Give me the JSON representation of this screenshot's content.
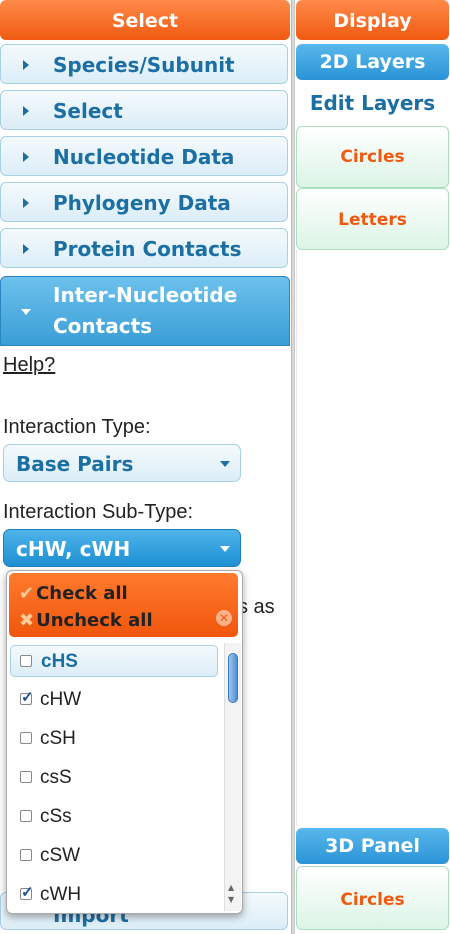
{
  "left_panel": {
    "header": "Select",
    "accordion": [
      {
        "label": "Species/Subunit"
      },
      {
        "label": "Select"
      },
      {
        "label": "Nucleotide Data"
      },
      {
        "label": "Phylogeny Data"
      },
      {
        "label": "Protein Contacts"
      }
    ],
    "open_section": {
      "line1": "Inter-Nucleotide",
      "line2": "Contacts"
    },
    "help_link": "Help?",
    "interaction_type": {
      "label": "Interaction Type:",
      "value": "Base Pairs"
    },
    "interaction_subtype": {
      "label": "Interaction Sub-Type:",
      "value": "cHW, cWH"
    },
    "partial_text": "s as",
    "dropdown": {
      "check_all": "Check all",
      "uncheck_all": "Uncheck all",
      "options": [
        {
          "label": "cHS",
          "checked": false,
          "hover": true
        },
        {
          "label": "cHW",
          "checked": true,
          "hover": false
        },
        {
          "label": "cSH",
          "checked": false,
          "hover": false
        },
        {
          "label": "csS",
          "checked": false,
          "hover": false
        },
        {
          "label": "cSs",
          "checked": false,
          "hover": false
        },
        {
          "label": "cSW",
          "checked": false,
          "hover": false
        },
        {
          "label": "cWH",
          "checked": true,
          "hover": false
        }
      ]
    },
    "bottom_section": "Import"
  },
  "right_panel": {
    "header": "Display",
    "tab_2d": "2D Layers",
    "edit_layers": "Edit Layers",
    "layers_2d": [
      "Circles",
      "Letters"
    ],
    "tab_3d": "3D Panel",
    "layers_3d": [
      "Circles"
    ]
  },
  "colors": {
    "orange": "#f05a10",
    "blue": "#1b6fa3",
    "light_blue_bg": "#dcedf7",
    "green_bg": "#dcf4e6"
  }
}
